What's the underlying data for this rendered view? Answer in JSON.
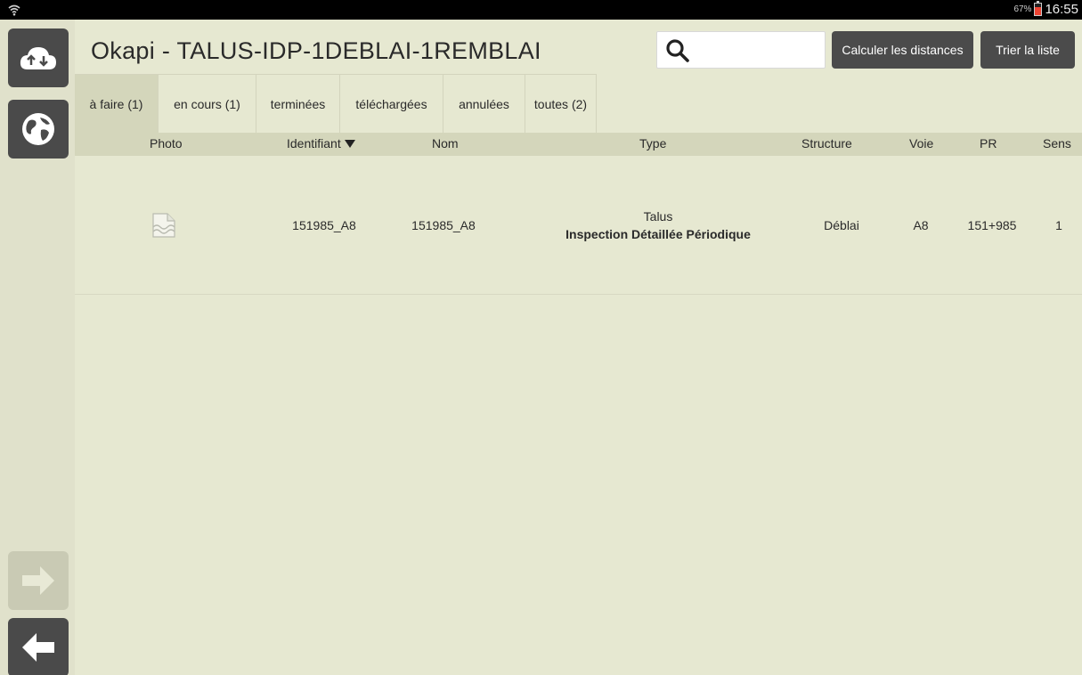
{
  "status": {
    "battery_pct": "67%",
    "time": "16:55"
  },
  "header": {
    "title": "Okapi - TALUS-IDP-1DEBLAI-1REMBLAI",
    "search_placeholder": "",
    "calc_label": "Calculer les distances",
    "sort_label": "Trier la liste"
  },
  "rail": {
    "items": [
      {
        "icon": "cloud-sync-icon"
      },
      {
        "icon": "globe-icon"
      },
      {
        "icon": "arrow-right-icon"
      },
      {
        "icon": "arrow-left-icon"
      }
    ]
  },
  "tabs": [
    {
      "label": "à faire (1)",
      "active": true
    },
    {
      "label": "en cours (1)",
      "active": false
    },
    {
      "label": "terminées",
      "active": false
    },
    {
      "label": "téléchargées",
      "active": false
    },
    {
      "label": "annulées",
      "active": false
    },
    {
      "label": "toutes (2)",
      "active": false
    }
  ],
  "table": {
    "columns": {
      "photo": "Photo",
      "identifiant": "Identifiant",
      "nom": "Nom",
      "type": "Type",
      "structure": "Structure",
      "voie": "Voie",
      "pr": "PR",
      "sens": "Sens"
    },
    "rows": [
      {
        "identifiant": "151985_A8",
        "nom": "151985_A8",
        "type": "Talus",
        "subtype": "Inspection Détaillée Périodique",
        "structure": "Déblai",
        "voie": "A8",
        "pr": "151+985",
        "sens": "1"
      }
    ]
  },
  "colors": {
    "background": "#e6e8d1",
    "header_band": "#d4d6bb",
    "button": "#4b4b4b"
  }
}
